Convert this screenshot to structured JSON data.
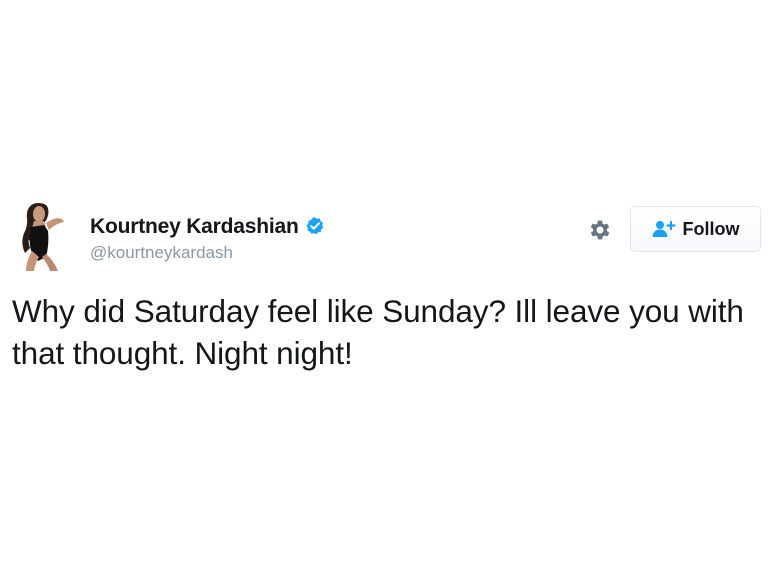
{
  "tweet": {
    "author": {
      "display_name": "Kourtney Kardashian",
      "handle": "@kourtneykardash",
      "verified": true,
      "avatar_icon": "profile-photo"
    },
    "actions": {
      "settings_icon": "gear-icon",
      "follow_label": "Follow",
      "follow_icon": "add-user-icon"
    },
    "text": "Why did Saturday feel like Sunday? Ill leave you with that thought. Night night!"
  },
  "colors": {
    "text": "#14171a",
    "handle": "#8899a6",
    "verified": "#1da1f2",
    "follow_icon": "#1da1f2",
    "button_border": "#e1e8ed",
    "gear": "#66757f"
  }
}
